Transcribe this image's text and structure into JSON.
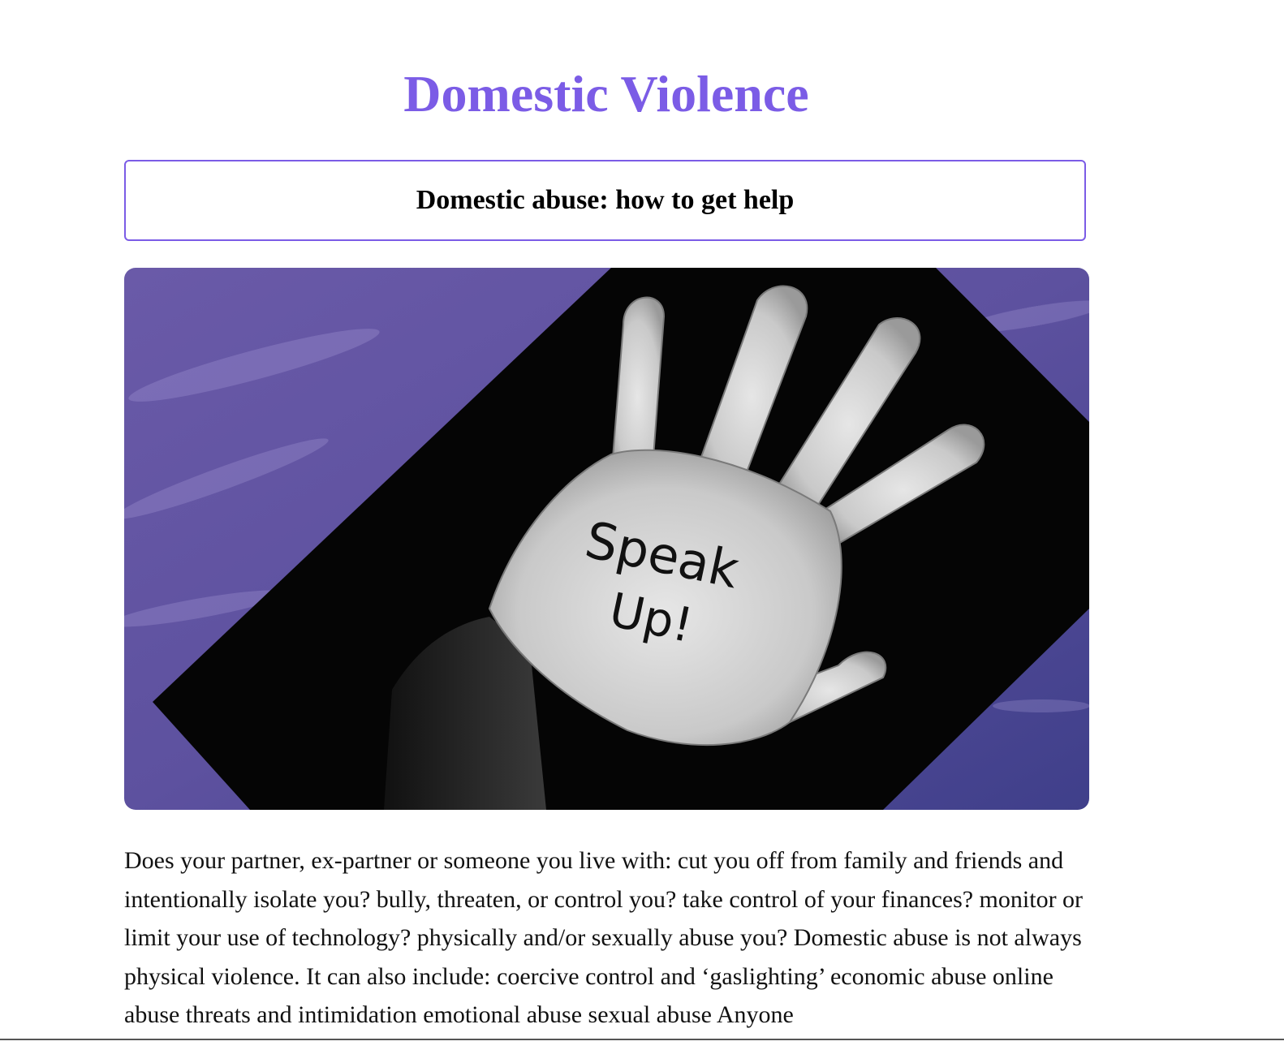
{
  "page": {
    "title": "Domestic Violence",
    "subtitle": "Domestic abuse: how to get help"
  },
  "hero_image": {
    "alt": "Hand with Speak Up! written on the palm",
    "palm_text_line1": "Speak",
    "palm_text_line2": "Up!"
  },
  "article": {
    "paragraph": "Does your partner, ex-partner or someone you live with: cut you off from family and friends and intentionally isolate you? bully, threaten, or control you? take control of your finances? monitor or limit your use of technology? physically and/or sexually abuse you? Domestic abuse is not always physical violence. It can also include: coercive control and ‘gaslighting’ economic abuse online abuse threats and intimidation emotional abuse sexual abuse Anyone"
  },
  "colors": {
    "accent": "#7b5ce6",
    "sky": "#5b4f9e"
  }
}
